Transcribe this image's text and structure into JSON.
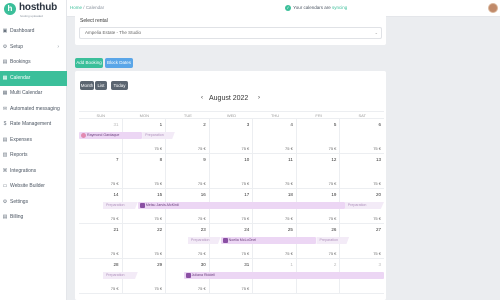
{
  "brand": {
    "name": "hosthub",
    "tagline": "hosting uploaded",
    "accent": "#3bbf9a"
  },
  "nav": {
    "items": [
      {
        "label": "Dashboard",
        "icon": "dashboard-icon"
      },
      {
        "label": "Setup",
        "icon": "gear-icon",
        "has_submenu": true
      },
      {
        "label": "Bookings",
        "icon": "list-icon"
      },
      {
        "label": "Calendar",
        "icon": "calendar-icon",
        "active": true
      },
      {
        "label": "Multi Calendar",
        "icon": "multi-calendar-icon"
      },
      {
        "label": "Automated messaging",
        "icon": "message-icon"
      },
      {
        "label": "Rate Management",
        "icon": "dollar-icon"
      },
      {
        "label": "Expenses",
        "icon": "expenses-icon"
      },
      {
        "label": "Reports",
        "icon": "chart-icon"
      },
      {
        "label": "Integrations",
        "icon": "integrations-icon"
      },
      {
        "label": "Website Builder",
        "icon": "website-icon"
      },
      {
        "label": "Settings",
        "icon": "gear-icon"
      },
      {
        "label": "Billing",
        "icon": "billing-icon"
      }
    ]
  },
  "topbar": {
    "breadcrumb": {
      "home": "Home",
      "separator": "/",
      "current": "Calendar"
    },
    "sync": {
      "prefix": "Your calendars are ",
      "status": "syncing"
    }
  },
  "rental": {
    "label": "Select rental",
    "selected": "Ampelia Estate - The Studio"
  },
  "actions": {
    "add_booking": "Add Booking",
    "block_dates": "Block Dates"
  },
  "calendar": {
    "views": [
      "Month",
      "List"
    ],
    "today": "Today",
    "month_label": "August 2022",
    "weekdays": [
      "SUN",
      "MON",
      "TUE",
      "WED",
      "THU",
      "FRI",
      "SAT"
    ],
    "weeks": [
      {
        "days": [
          {
            "n": "31",
            "muted": true,
            "price": ""
          },
          {
            "n": "1",
            "price": "75 €"
          },
          {
            "n": "2",
            "price": "75 €"
          },
          {
            "n": "3",
            "price": "75 €"
          },
          {
            "n": "4",
            "price": "75 €"
          },
          {
            "n": "5",
            "price": "75 €"
          },
          {
            "n": "6",
            "price": "75 €"
          }
        ],
        "bars": [
          {
            "kind": "res",
            "start": 0,
            "span": 1.45,
            "label": "Raymond Gardaque",
            "icon": "pink"
          },
          {
            "kind": "prep",
            "start": 1.45,
            "span": 0.75,
            "label": "Preparation"
          }
        ]
      },
      {
        "days": [
          {
            "n": "7",
            "price": "75 €"
          },
          {
            "n": "8",
            "price": "75 €"
          },
          {
            "n": "9",
            "price": "75 €"
          },
          {
            "n": "10",
            "price": "75 €"
          },
          {
            "n": "11",
            "price": "75 €"
          },
          {
            "n": "12",
            "price": "75 €"
          },
          {
            "n": "13",
            "price": "75 €"
          }
        ],
        "bars": []
      },
      {
        "days": [
          {
            "n": "14",
            "price": "75 €"
          },
          {
            "n": "15",
            "price": "75 €"
          },
          {
            "n": "16",
            "price": "75 €"
          },
          {
            "n": "17",
            "price": "75 €"
          },
          {
            "n": "18",
            "price": "75 €"
          },
          {
            "n": "19",
            "price": "75 €"
          },
          {
            "n": "20",
            "price": "75 €"
          }
        ],
        "bars": [
          {
            "kind": "prep",
            "start": 0.55,
            "span": 0.8,
            "label": "Preparation"
          },
          {
            "kind": "res",
            "start": 1.35,
            "span": 4.75,
            "label": "Melsu Jarvis-McKirdi",
            "icon": "purple"
          },
          {
            "kind": "prep",
            "start": 6.1,
            "span": 0.9,
            "label": "Preparation"
          }
        ]
      },
      {
        "days": [
          {
            "n": "21",
            "price": "75 €"
          },
          {
            "n": "22",
            "price": "75 €"
          },
          {
            "n": "23",
            "price": "75 €"
          },
          {
            "n": "24",
            "price": "75 €"
          },
          {
            "n": "25",
            "price": "75 €"
          },
          {
            "n": "26",
            "price": "75 €"
          },
          {
            "n": "27",
            "price": "75 €"
          }
        ],
        "bars": [
          {
            "kind": "prep",
            "start": 2.5,
            "span": 0.75,
            "label": "Preparation"
          },
          {
            "kind": "res",
            "start": 3.25,
            "span": 2.2,
            "label": "Noelia McLoOnel",
            "icon": "purple"
          },
          {
            "kind": "prep",
            "start": 5.45,
            "span": 0.75,
            "label": "Preparation"
          }
        ]
      },
      {
        "days": [
          {
            "n": "28",
            "price": "75 €"
          },
          {
            "n": "29",
            "price": "75 €"
          },
          {
            "n": "30",
            "price": "75 €"
          },
          {
            "n": "31",
            "price": "75 €"
          },
          {
            "n": "1",
            "muted": true,
            "price": ""
          },
          {
            "n": "2",
            "muted": true,
            "price": ""
          },
          {
            "n": "3",
            "muted": true,
            "price": ""
          }
        ],
        "bars": [
          {
            "kind": "prep",
            "start": 0.55,
            "span": 0.8,
            "label": "Preparation"
          },
          {
            "kind": "res",
            "start": 2.4,
            "span": 4.6,
            "label": "Juliana Riddell",
            "icon": "purple"
          }
        ]
      }
    ]
  }
}
